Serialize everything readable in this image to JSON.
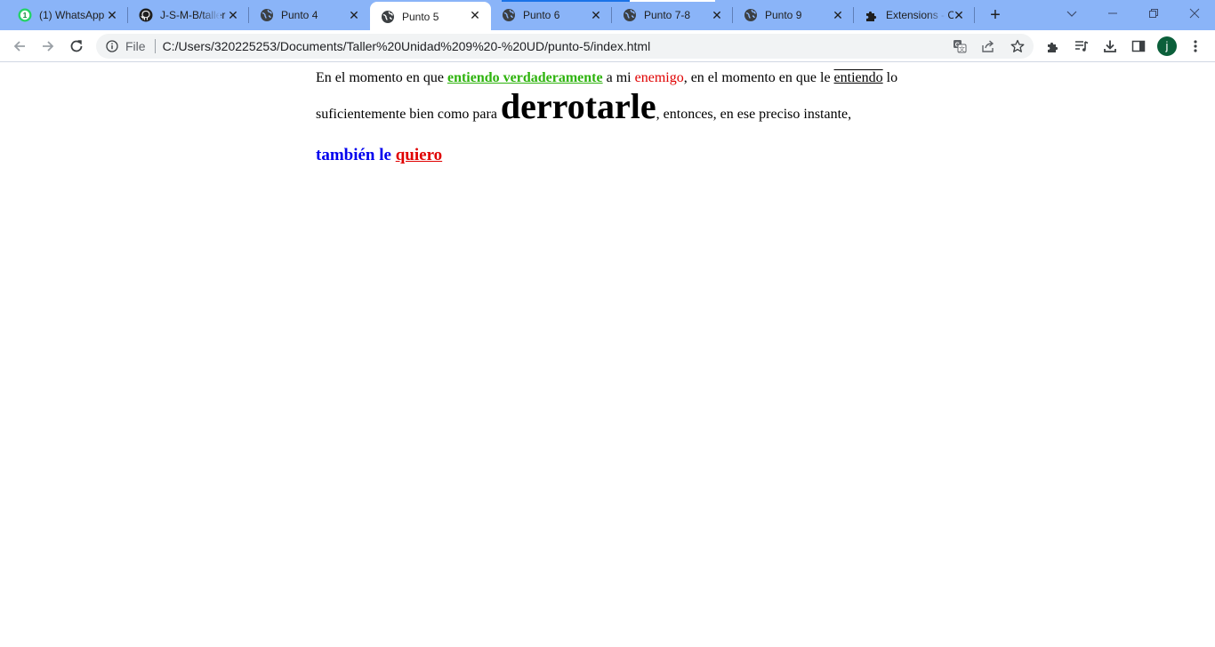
{
  "browser": {
    "tabs": [
      {
        "title": "(1) WhatsApp",
        "icon": "whatsapp-icon",
        "active": false
      },
      {
        "title": "J-S-M-B/taller",
        "icon": "github-icon",
        "active": false
      },
      {
        "title": "Punto 4",
        "icon": "globe-icon",
        "active": false
      },
      {
        "title": "Punto 5",
        "icon": "globe-icon",
        "active": true
      },
      {
        "title": "Punto 6",
        "icon": "globe-icon",
        "active": false
      },
      {
        "title": "Punto 7-8",
        "icon": "globe-icon",
        "active": false
      },
      {
        "title": "Punto 9",
        "icon": "globe-icon",
        "active": false
      },
      {
        "title": "Extensions - Chrome",
        "icon": "puzzle-icon",
        "active": false
      }
    ],
    "whatsapp_badge": "1",
    "new_tab_label": "+",
    "address": {
      "scheme_label": "File",
      "url": "C:/Users/320225253/Documents/Taller%20Unidad%209%20-%20UD/punto-5/index.html"
    },
    "profile_initial": "j",
    "colors": {
      "tabstrip": "#8ab4f8",
      "active_tab": "#ffffff",
      "profile": "#0b5f3a"
    }
  },
  "content": {
    "p1": {
      "t1": "En el momento en que ",
      "t2": "entiendo verdaderamente",
      "t3": " a mi ",
      "t4": "enemigo",
      "t5": ", en el momento en que le ",
      "t6": "entiendo",
      "t7": " lo suficientemente bien como para ",
      "t8": "derrotarle",
      "t9": ", entonces, en ese preciso instante,"
    },
    "p2": {
      "t1": "también le ",
      "t2": "quiero"
    },
    "colors": {
      "green": "#2db30c",
      "red": "#e00000",
      "blue": "#0000ee"
    }
  }
}
